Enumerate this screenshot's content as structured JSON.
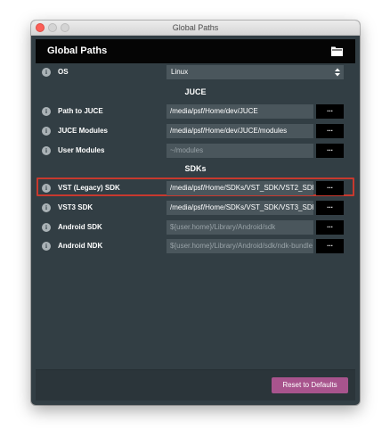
{
  "window": {
    "title": "Global Paths"
  },
  "header": {
    "title": "Global Paths",
    "icon": "folder-icon"
  },
  "os": {
    "label": "OS",
    "value": "Linux"
  },
  "sections": {
    "juce": "JUCE",
    "sdks": "SDKs"
  },
  "rows": [
    {
      "label": "Path to JUCE",
      "value": "/media/psf/Home/dev/JUCE",
      "placeholder": false
    },
    {
      "label": "JUCE Modules",
      "value": "/media/psf/Home/dev/JUCE/modules",
      "placeholder": false
    },
    {
      "label": "User Modules",
      "value": "~/modules",
      "placeholder": true
    },
    {
      "label": "VST (Legacy) SDK",
      "value": "/media/psf/Home/SDKs/VST_SDK/VST2_SDK",
      "placeholder": false
    },
    {
      "label": "VST3 SDK",
      "value": "/media/psf/Home/SDKs/VST_SDK/VST3_SDK",
      "placeholder": false
    },
    {
      "label": "Android SDK",
      "value": "${user.home}/Library/Android/sdk",
      "placeholder": true
    },
    {
      "label": "Android NDK",
      "value": "${user.home}/Library/Android/sdk/ndk-bundle",
      "placeholder": true
    }
  ],
  "browse_label": "...",
  "info_glyph": "i",
  "footer": {
    "reset_label": "Reset to Defaults"
  },
  "colors": {
    "accent": "#a8548d",
    "highlight": "#c8392e",
    "background": "#323e44"
  }
}
